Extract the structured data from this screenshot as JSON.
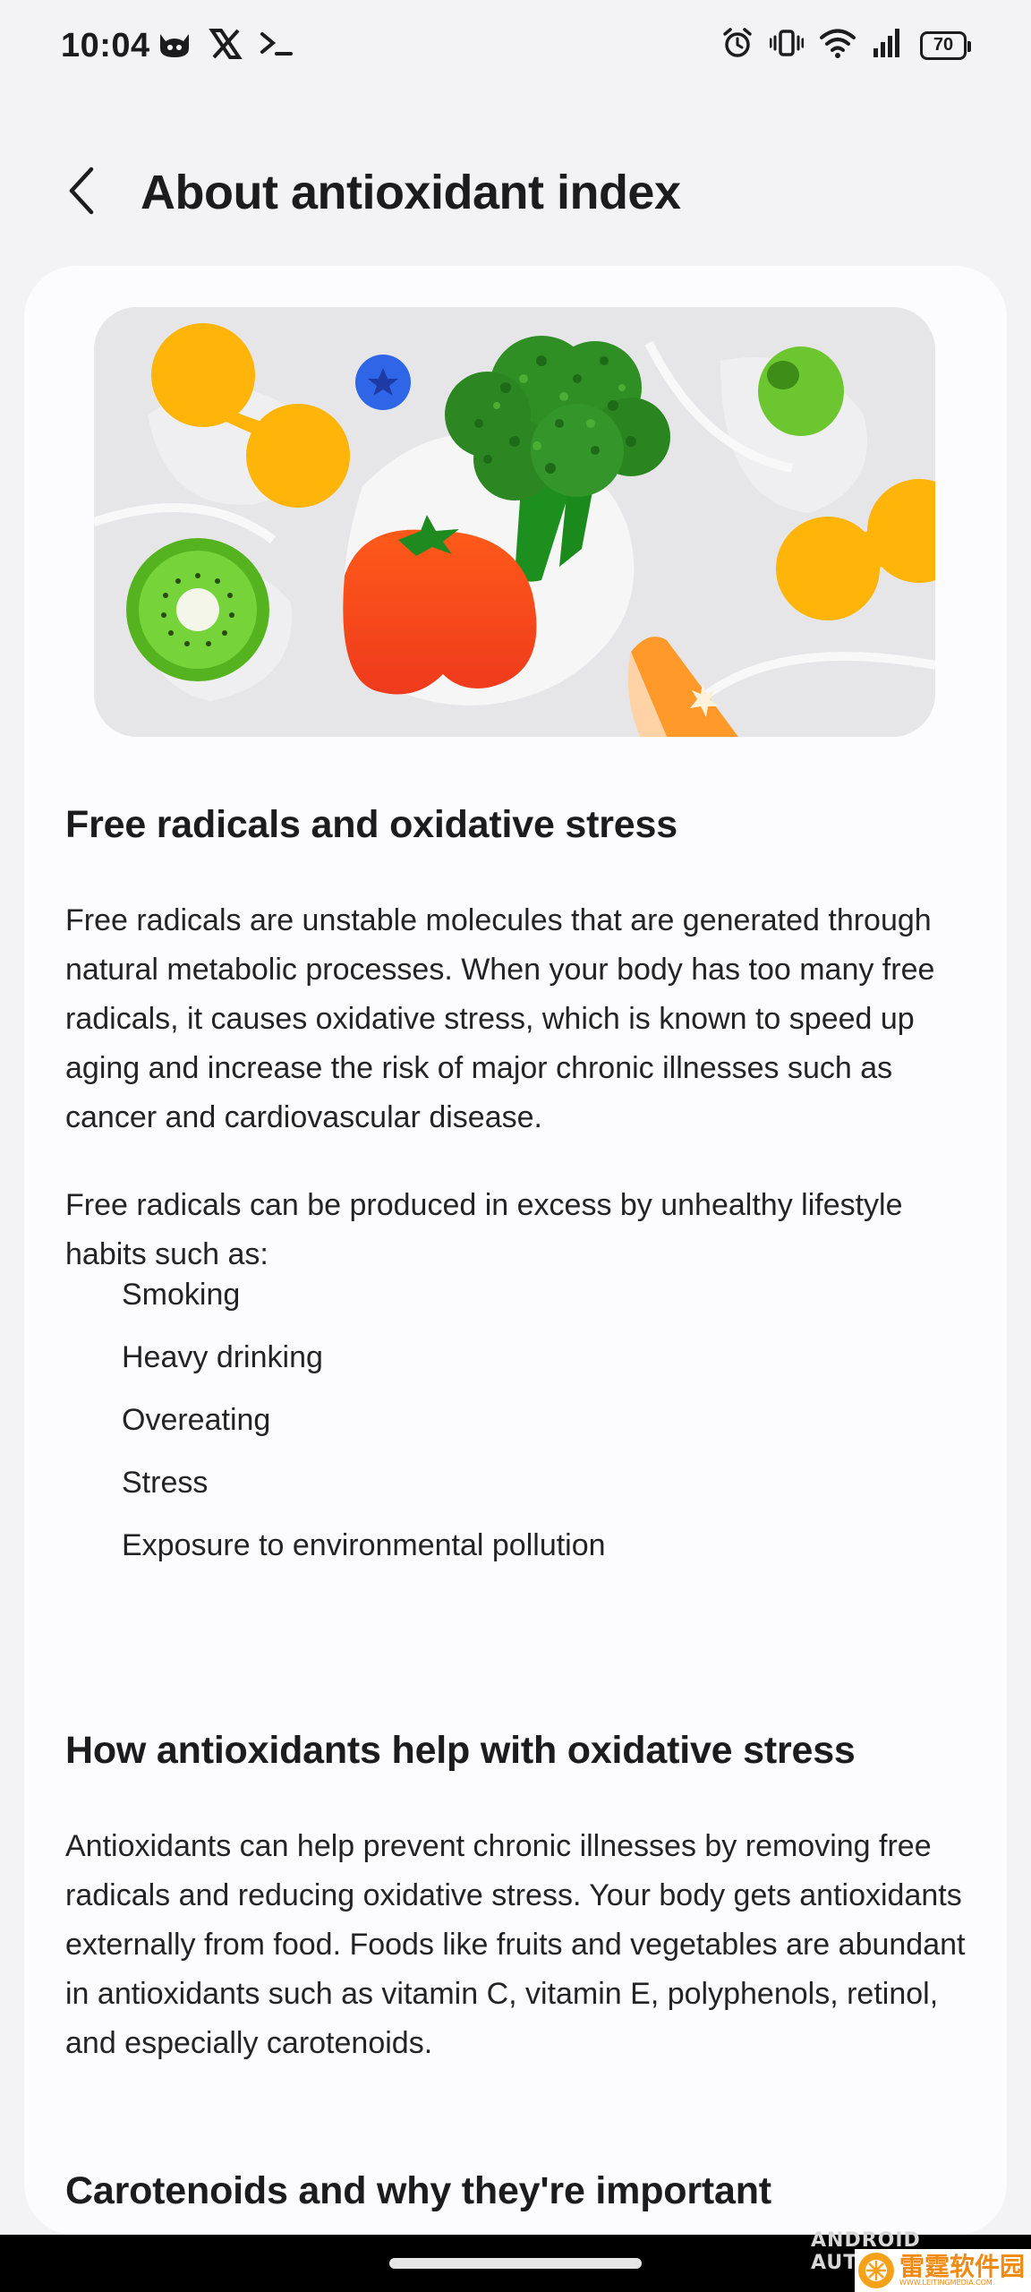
{
  "status_bar": {
    "time": "10:04",
    "battery": "70",
    "left_icons": [
      "cat-app-icon",
      "x-icon",
      "terminal-icon"
    ],
    "right_icons": [
      "alarm-icon",
      "vibrate-icon",
      "wifi-icon",
      "signal-icon",
      "battery-icon"
    ]
  },
  "header": {
    "title": "About antioxidant index",
    "back_icon": "chevron-left-icon"
  },
  "hero_image": {
    "description_icons": [
      "orange-molecule",
      "blueberry",
      "broccoli",
      "olive",
      "kiwi",
      "tomato",
      "orange-slice"
    ]
  },
  "sections": [
    {
      "heading": "Free radicals and oxidative stress",
      "paragraphs": [
        "Free radicals are unstable molecules that are generated through natural metabolic processes. When your body has too many free radicals, it causes oxidative stress, which is known to speed up aging and increase the risk of major chronic illnesses such as cancer and cardiovascular disease.",
        "Free radicals can be produced in excess by unhealthy lifestyle habits such as:"
      ],
      "list": [
        "Smoking",
        "Heavy drinking",
        "Overeating",
        "Stress",
        "Exposure to environmental pollution"
      ]
    },
    {
      "heading": "How antioxidants help with oxidative stress",
      "paragraphs": [
        "Antioxidants can help prevent chronic illnesses by removing free radicals and reducing oxidative stress. Your body gets antioxidants externally from food. Foods like fruits and vegetables are abundant in antioxidants such as vitamin C, vitamin E, polyphenols, retinol, and especially carotenoids."
      ]
    },
    {
      "heading": "Carotenoids and why they're important"
    }
  ],
  "watermarks": {
    "top": "ANDROID AUTHORITY",
    "cn": "雷霆软件园",
    "en": "WWW.LEITINGMEDIA.COM"
  },
  "colors": {
    "background": "#f3f3f6",
    "card": "#fcfcfe",
    "text": "#1c1c1e"
  }
}
